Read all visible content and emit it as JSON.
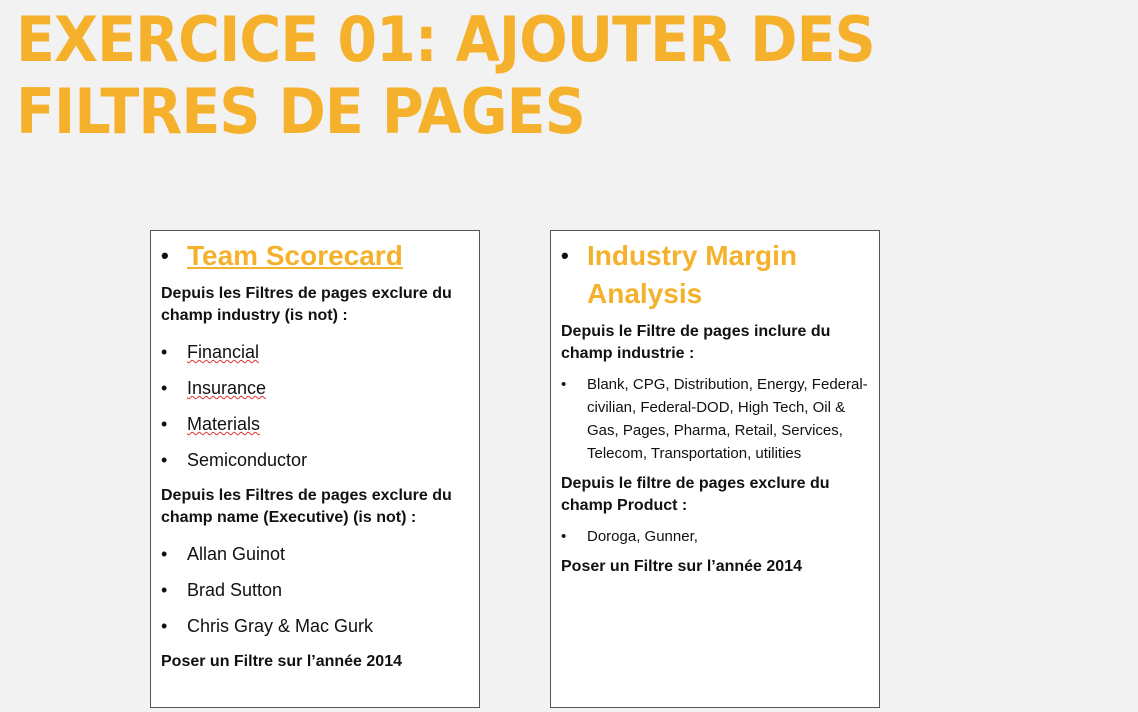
{
  "slide": {
    "title": "EXERCICE 01: AJOUTER DES FILTRES DE PAGES"
  },
  "left_box": {
    "title": "Team Scorecard",
    "para1": "Depuis les Filtres de pages exclure du champ industry (is not) :",
    "list1": [
      "Financial",
      "Insurance",
      "Materials",
      "Semiconductor"
    ],
    "para2": "Depuis les Filtres de pages exclure du champ name (Executive)  (is not) :",
    "list2": [
      "Allan Guinot",
      "Brad Sutton",
      "Chris Gray & Mac Gurk"
    ],
    "para3": "Poser un Filtre sur l’année 2014"
  },
  "right_box": {
    "title": "Industry Margin Analysis",
    "para1": "Depuis le Filtre de pages inclure du champ industrie :",
    "list1": [
      "Blank, CPG, Distribution, Energy, Federal-civilian, Federal-DOD, High Tech, Oil & Gas, Pages, Pharma, Retail, Services, Telecom, Transportation, utilities"
    ],
    "para2": "Depuis le filtre de pages exclure du champ Product :",
    "list2": [
      "Doroga, Gunner,"
    ],
    "para3": "Poser un Filtre sur l’année 2014"
  },
  "colors": {
    "accent": "#f5b12b",
    "background": "#f2f2f2"
  }
}
